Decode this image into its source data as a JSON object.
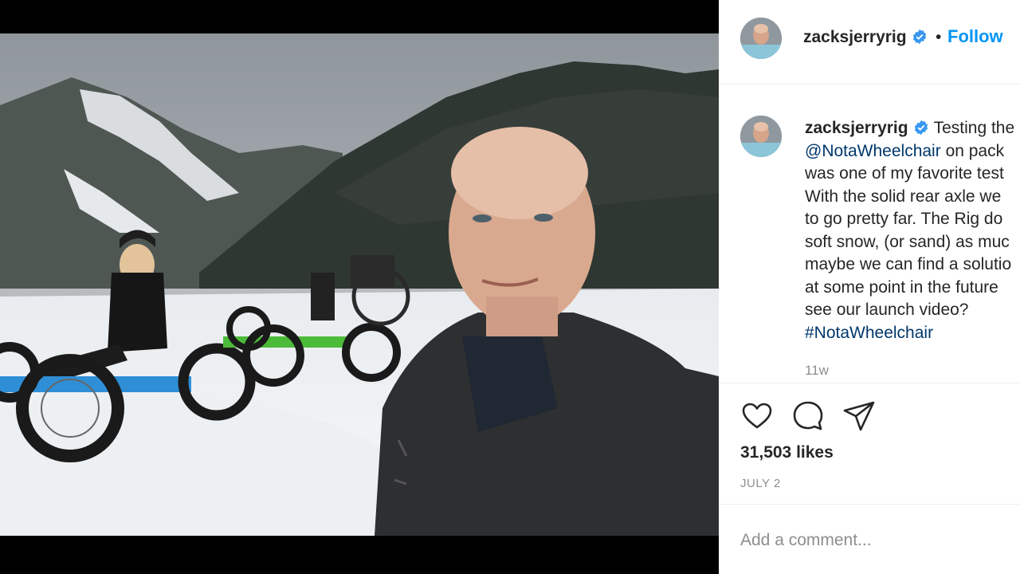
{
  "post": {
    "username": "zacksjerryrig",
    "follow_label": "Follow",
    "separator": "•",
    "caption_lines": [
      "Testing the",
      "on pack",
      "was one of my favorite test",
      "With the solid rear axle we",
      "to go pretty far. The Rig do",
      "soft snow, (or sand) as muc",
      "maybe we can find a solutio",
      "at some point in the future",
      "see our launch video?"
    ],
    "mention": "@NotaWheelchair",
    "hashtag": "#NotaWheelchair",
    "time_ago": "11w",
    "likes": "31,503 likes",
    "date": "JULY 2"
  },
  "comment": {
    "placeholder": "Add a comment..."
  },
  "icons": {
    "like": "heart-icon",
    "comment": "comment-bubble-icon",
    "share": "paper-plane-icon",
    "verified": "verified-badge-icon"
  },
  "colors": {
    "link_blue": "#0095f6",
    "verified_blue": "#3897f0",
    "text": "#262626",
    "muted": "#8e8e8e"
  }
}
